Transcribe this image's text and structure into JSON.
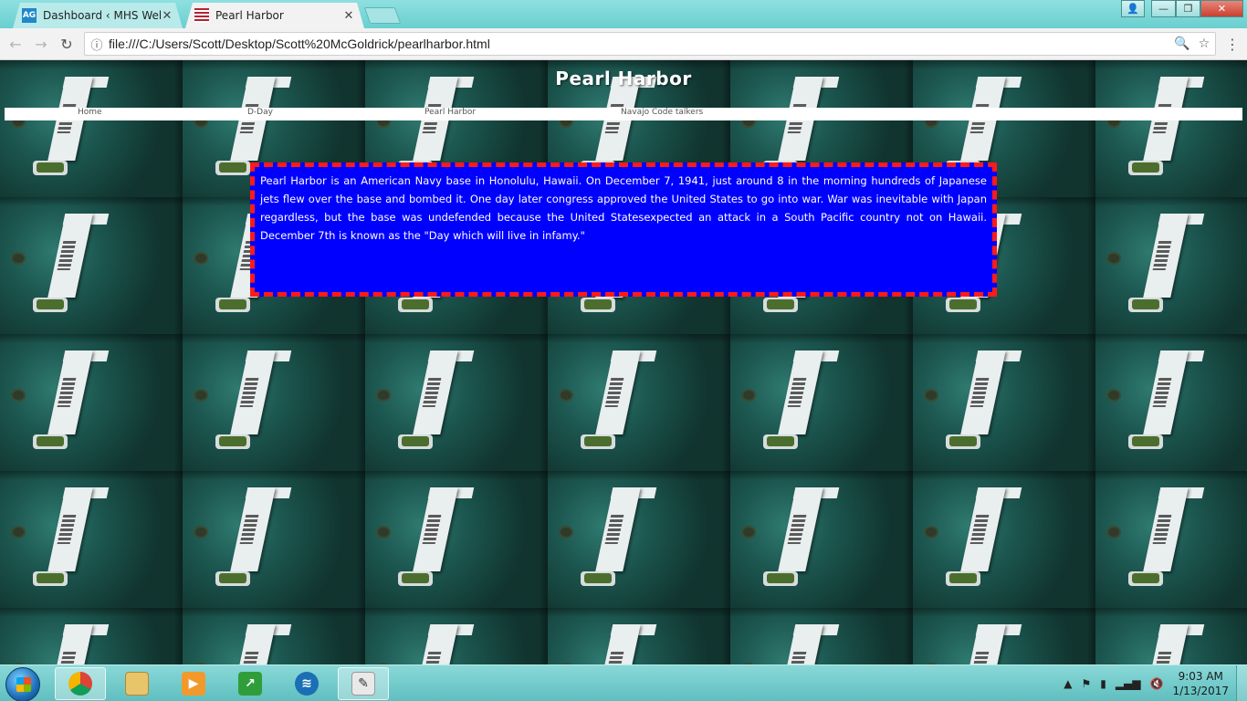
{
  "browser": {
    "tabs": [
      {
        "favicon": "AG",
        "title": "Dashboard ‹ MHS Web D",
        "active": false
      },
      {
        "favicon": "flag",
        "title": "Pearl Harbor",
        "active": true
      }
    ],
    "url": "file:///C:/Users/Scott/Desktop/Scott%20McGoldrick/pearlharbor.html",
    "icons": {
      "back": "arrow-left-icon",
      "forward": "arrow-right-icon",
      "reload": "reload-icon",
      "info": "info-icon",
      "zoom": "zoom-icon",
      "bookmark": "star-icon",
      "menu": "kebab-menu-icon"
    }
  },
  "page": {
    "title": "Pearl Harbor",
    "nav": [
      {
        "label": "Home"
      },
      {
        "label": "D-Day"
      },
      {
        "label": "Pearl Harbor"
      },
      {
        "label": "Navajo Code talkers"
      }
    ],
    "content": "Pearl Harbor is an American Navy base in Honolulu, Hawaii. On December 7, 1941, just around 8 in the morning hundreds of Japanese jets flew over the base and bombed it. One day later congress approved the United States to go into war. War was inevitable with Japan regardless, but the base was undefended because the United Statesexpected an attack in a South Pacific country not on Hawaii. December 7th is known as the \"Day which will live in infamy.\"",
    "colors": {
      "box_bg": "#0000ff",
      "box_border": "#ff1a1a",
      "text": "#ffffff"
    }
  },
  "taskbar": {
    "apps": [
      "chrome",
      "file-explorer",
      "media-player",
      "task-app",
      "wifi-app",
      "notepad-app"
    ],
    "time": "9:03 AM",
    "date": "1/13/2017"
  }
}
